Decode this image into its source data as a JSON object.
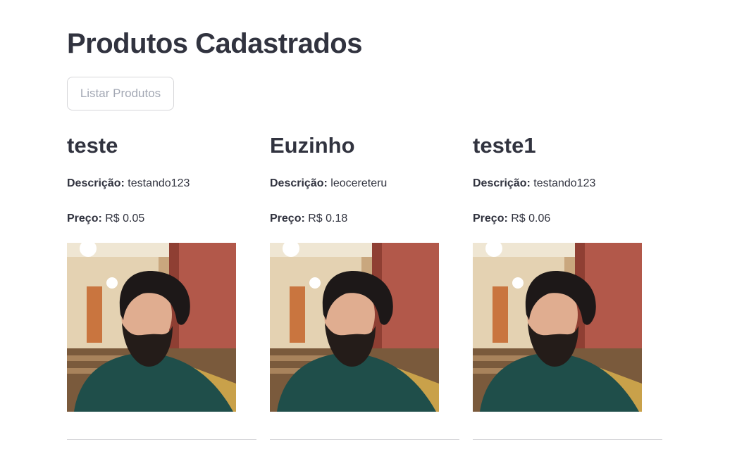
{
  "page": {
    "title": "Produtos Cadastrados",
    "list_button_label": "Listar Produtos"
  },
  "labels": {
    "description": "Descrição:",
    "price": "Preço:"
  },
  "products": [
    {
      "name": "teste",
      "description": "testando123",
      "price": "R$ 0.05"
    },
    {
      "name": "Euzinho",
      "description": "leocereteru",
      "price": "R$ 0.18"
    },
    {
      "name": "teste1",
      "description": "testando123",
      "price": "R$ 0.06"
    }
  ],
  "colors": {
    "text": "#31333f",
    "button_border": "#d6d6d9",
    "button_text": "#a3a8b4",
    "divider": "#d9d9dc"
  }
}
